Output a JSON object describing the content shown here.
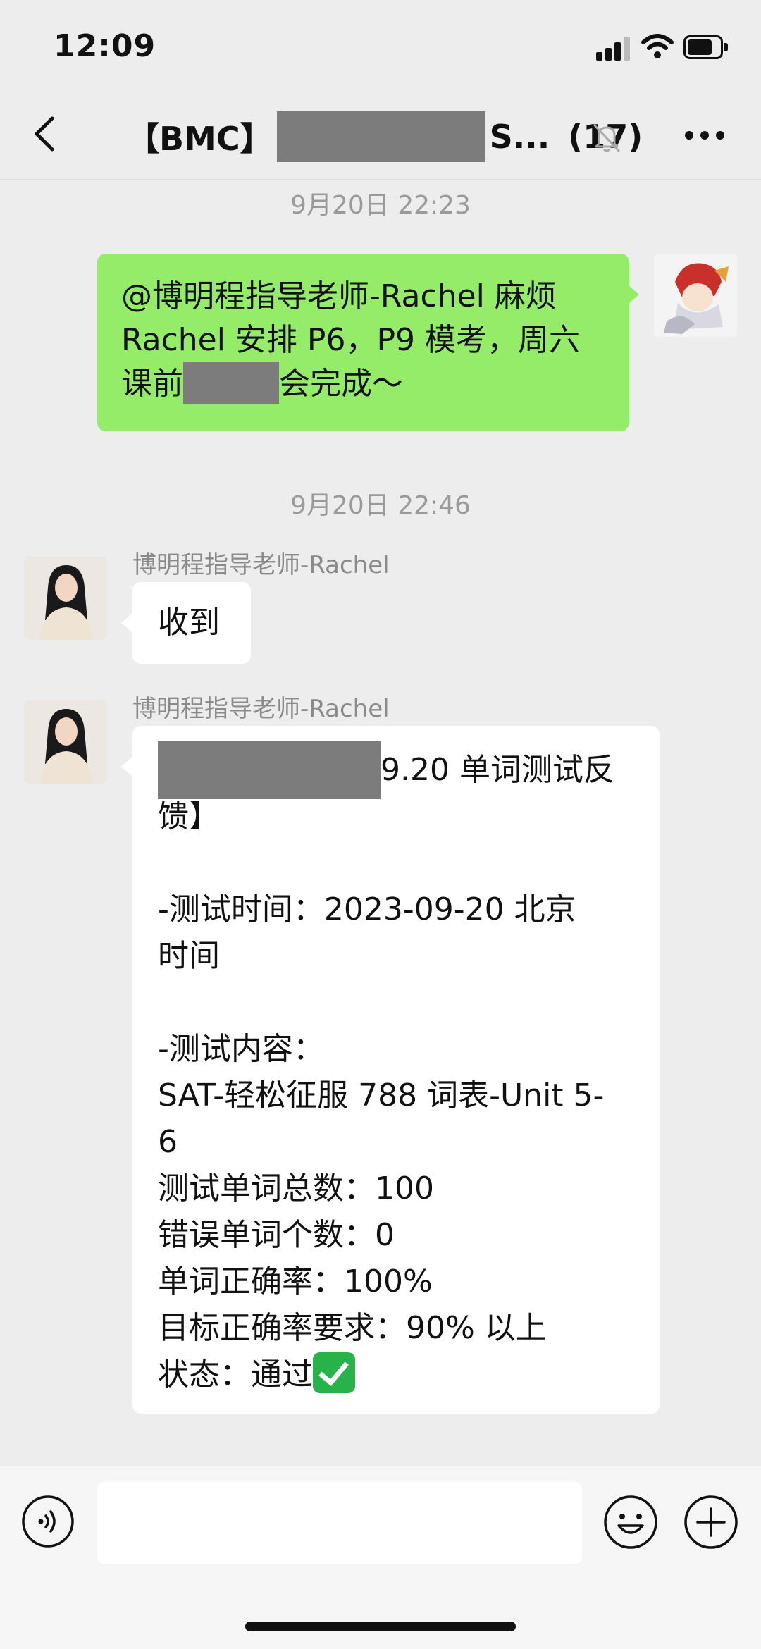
{
  "status_bar": {
    "time": "12:09"
  },
  "nav": {
    "title_prefix": "【BMC】",
    "title_suffix": "S...",
    "member_count": "(17)"
  },
  "messages": [
    {
      "timestamp": "9月20日 22:23",
      "sender": "me",
      "text_line1": "@博明程指导老师-Rachel 麻烦",
      "text_line2": "Rachel 安排 P6，P9 模考，周六",
      "text_line3_before": "课前",
      "text_line3_after": "会完成～"
    },
    {
      "timestamp": "9月20日 22:46"
    },
    {
      "sender_name": "博明程指导老师-Rachel",
      "text": "收到"
    },
    {
      "sender_name": "博明程指导老师-Rachel",
      "feedback": {
        "line1_suffix": "9.20 单词测试反",
        "line2": "馈】",
        "line3": "",
        "line4": "-测试时间：2023-09-20 北京",
        "line5": "时间",
        "line6": "",
        "line7": "-测试内容：",
        "line8": "SAT-轻松征服 788 词表-Unit 5-",
        "line9": "6",
        "line10": "测试单词总数：100",
        "line11": "错误单词个数：0",
        "line12": "单词正确率：100%",
        "line13": "目标正确率要求：90% 以上",
        "line14": "状态：通过"
      }
    }
  ],
  "colors": {
    "self_bubble": "#95ec69",
    "background": "#ededed",
    "redaction": "#7c7c7c"
  }
}
